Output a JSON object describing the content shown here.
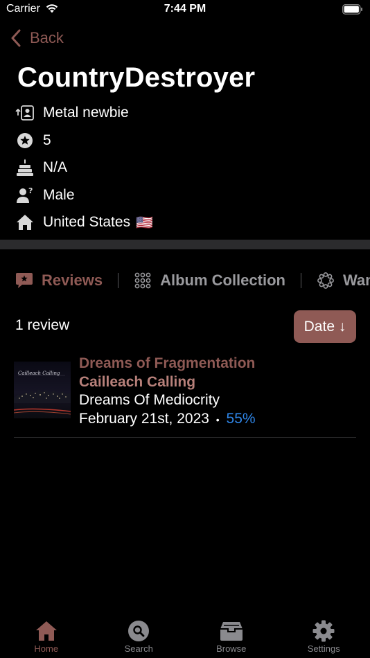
{
  "status_bar": {
    "carrier": "Carrier",
    "time": "7:44 PM"
  },
  "nav": {
    "back_label": "Back"
  },
  "profile": {
    "username": "CountryDestroyer",
    "rank": "Metal newbie",
    "points": "5",
    "age": "N/A",
    "gender": "Male",
    "country": "United States",
    "country_flag": "🇺🇸"
  },
  "tabs": [
    {
      "label": "Reviews",
      "icon": "speech-bubble-star-icon",
      "active": true
    },
    {
      "label": "Album Collection",
      "icon": "grid-dots-icon",
      "active": false
    },
    {
      "label": "Want",
      "icon": "ring-dots-icon",
      "active": false
    }
  ],
  "reviews": {
    "count_label": "1 review",
    "sort_label": "Date ↓",
    "items": [
      {
        "title": "Dreams of Fragmentation",
        "artist": "Cailleach Calling",
        "album": "Dreams Of Mediocrity",
        "date": "February 21st, 2023",
        "separator": "•",
        "score": "55%"
      }
    ]
  },
  "tab_bar": [
    {
      "label": "Home",
      "icon": "home-icon",
      "active": true
    },
    {
      "label": "Search",
      "icon": "search-icon",
      "active": false
    },
    {
      "label": "Browse",
      "icon": "archive-box-icon",
      "active": false
    },
    {
      "label": "Settings",
      "icon": "gear-icon",
      "active": false
    }
  ],
  "colors": {
    "accent": "#8f5a55",
    "accent_light": "#b7807a",
    "score_blue": "#2f86e8",
    "background": "#000000",
    "divider": "#2b2b2d"
  }
}
